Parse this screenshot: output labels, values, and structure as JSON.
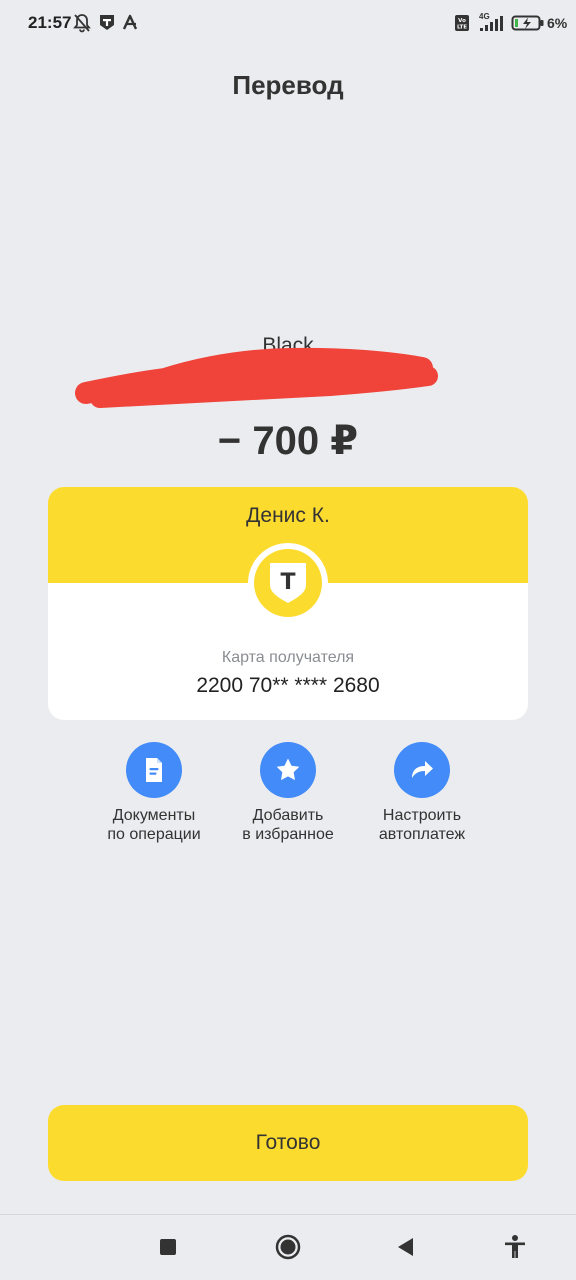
{
  "status_bar": {
    "time": "21:57",
    "battery_percent": "6%",
    "network_label": "4G",
    "icons": [
      "bell-off-icon",
      "bank-app-icon",
      "a-icon",
      "volte-icon",
      "signal-icon",
      "battery-charging-icon"
    ]
  },
  "header": {
    "title": "Перевод"
  },
  "transfer": {
    "account_name": "Black",
    "amount": "− 700 ₽"
  },
  "recipient": {
    "name": "Денис К.",
    "card_label": "Карта получателя",
    "card_number": "2200 70** **** 2680",
    "logo_letter": "Т"
  },
  "actions": [
    {
      "label_line1": "Документы",
      "label_line2": "по операции",
      "icon": "document-icon"
    },
    {
      "label_line1": "Добавить",
      "label_line2": "в избранное",
      "icon": "star-icon"
    },
    {
      "label_line1": "Настроить",
      "label_line2": "автоплатеж",
      "icon": "share-arrow-icon"
    }
  ],
  "footer": {
    "done_label": "Готово"
  },
  "navigation": {
    "buttons": [
      "recent-apps-icon",
      "home-icon",
      "back-icon",
      "accessibility-icon"
    ]
  },
  "colors": {
    "background": "#ebecef",
    "brand_yellow": "#fcdb2f",
    "action_blue": "#428bf9",
    "redaction_red": "#f0433a"
  }
}
